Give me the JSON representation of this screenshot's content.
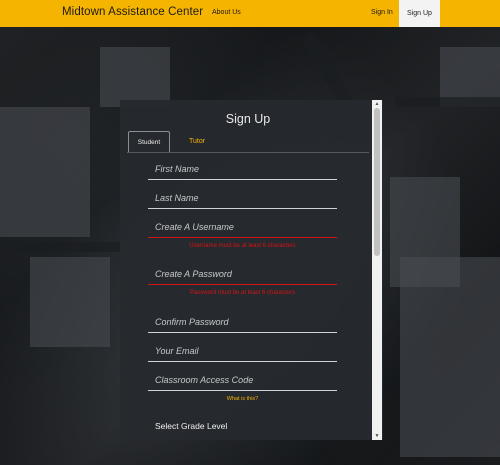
{
  "nav": {
    "brand": "Midtown Assistance Center",
    "about": "About Us",
    "sign_in": "Sign In",
    "sign_up": "Sign Up",
    "color": "#f5b400"
  },
  "modal": {
    "title": "Sign Up",
    "tabs": {
      "student": "Student",
      "tutor": "Tutor"
    },
    "fields": {
      "first_name": "First Name",
      "last_name": "Last Name",
      "username": "Create A Username",
      "password": "Create A Password",
      "confirm_password": "Confirm Password",
      "email": "Your Email",
      "access_code": "Classroom Access Code"
    },
    "errors": {
      "username": "Username must be at least 6 characters",
      "password": "Password must be at least 6 characters"
    },
    "what_is_this": "What is this?",
    "grade_label": "Select Grade Level"
  }
}
